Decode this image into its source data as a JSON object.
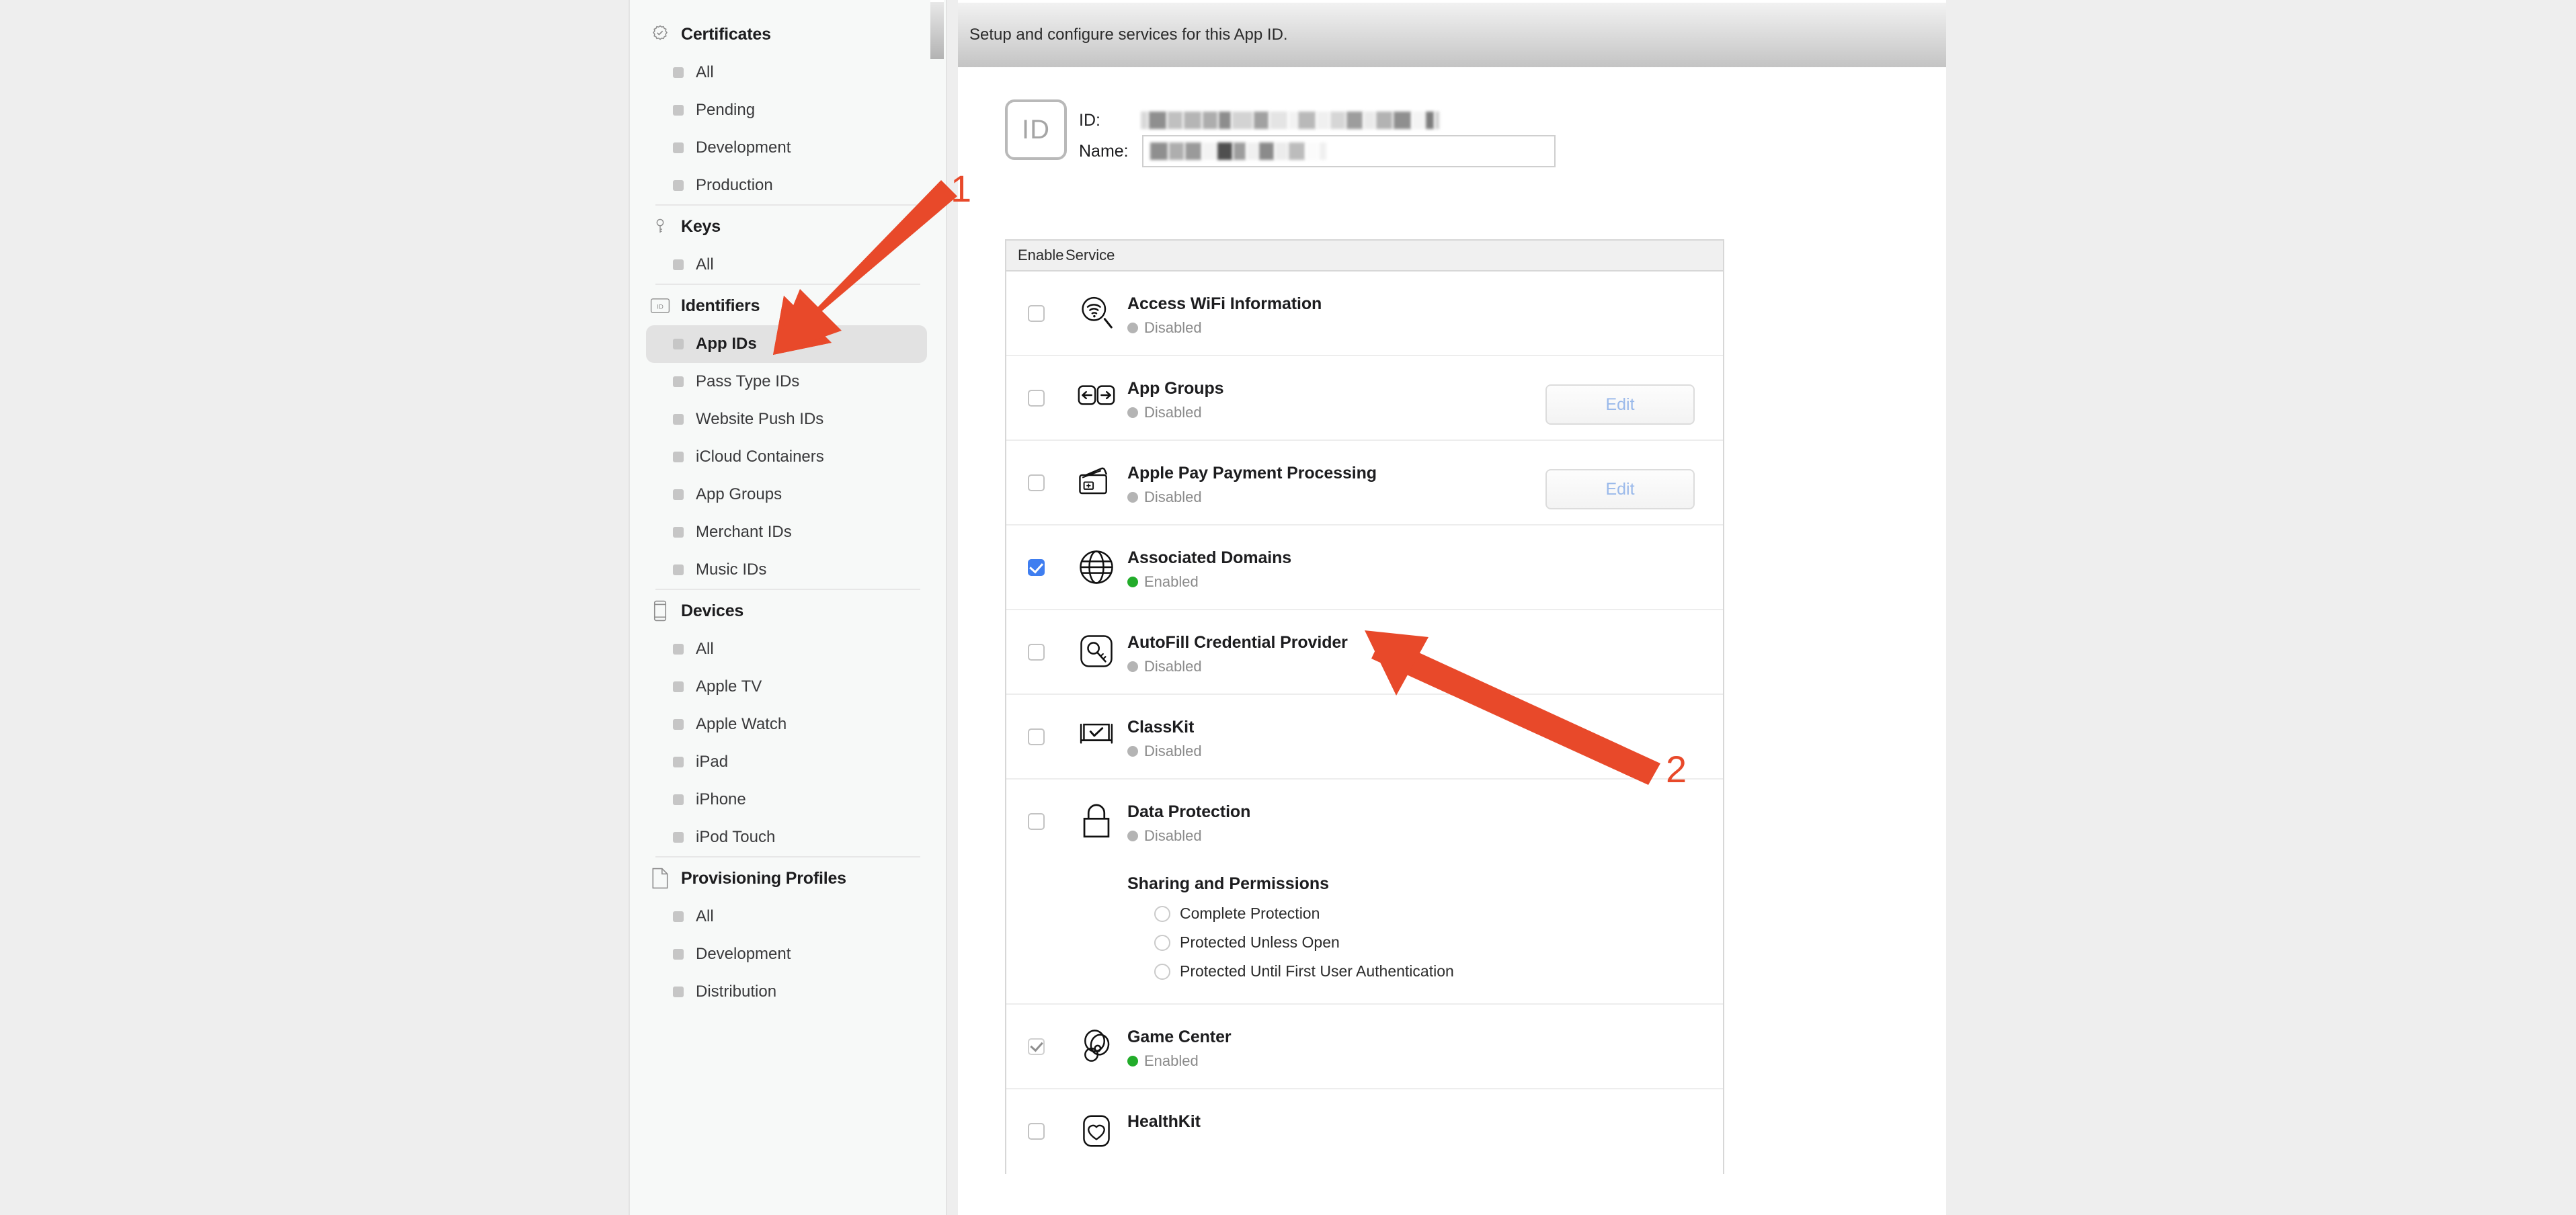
{
  "sidebar": {
    "groups": [
      {
        "label": "Certificates",
        "icon": "certificate-seal-icon",
        "items": [
          {
            "label": "All",
            "selected": false
          },
          {
            "label": "Pending",
            "selected": false
          },
          {
            "label": "Development",
            "selected": false
          },
          {
            "label": "Production",
            "selected": false
          }
        ]
      },
      {
        "label": "Keys",
        "icon": "key-icon",
        "items": [
          {
            "label": "All",
            "selected": false
          }
        ]
      },
      {
        "label": "Identifiers",
        "icon": "id-card-icon",
        "items": [
          {
            "label": "App IDs",
            "selected": true
          },
          {
            "label": "Pass Type IDs",
            "selected": false
          },
          {
            "label": "Website Push IDs",
            "selected": false
          },
          {
            "label": "iCloud Containers",
            "selected": false
          },
          {
            "label": "App Groups",
            "selected": false
          },
          {
            "label": "Merchant IDs",
            "selected": false
          },
          {
            "label": "Music IDs",
            "selected": false
          }
        ]
      },
      {
        "label": "Devices",
        "icon": "device-phone-icon",
        "items": [
          {
            "label": "All",
            "selected": false
          },
          {
            "label": "Apple TV",
            "selected": false
          },
          {
            "label": "Apple Watch",
            "selected": false
          },
          {
            "label": "iPad",
            "selected": false
          },
          {
            "label": "iPhone",
            "selected": false
          },
          {
            "label": "iPod Touch",
            "selected": false
          }
        ]
      },
      {
        "label": "Provisioning Profiles",
        "icon": "document-page-icon",
        "items": [
          {
            "label": "All",
            "selected": false
          },
          {
            "label": "Development",
            "selected": false
          },
          {
            "label": "Distribution",
            "selected": false
          }
        ]
      }
    ]
  },
  "main": {
    "header_text": "Setup and configure services for this App ID.",
    "id_badge_label": "ID",
    "id_label": "ID:",
    "name_label": "Name:",
    "id_value": "",
    "name_value": "",
    "table": {
      "columns": [
        "Enable",
        "Service"
      ],
      "rows": [
        {
          "name": "Access WiFi Information",
          "icon": "wifi-magnifier-icon",
          "status": "Disabled",
          "enabled": false,
          "checkbox": "unchecked",
          "action": null
        },
        {
          "name": "App Groups",
          "icon": "app-groups-arrows-icon",
          "status": "Disabled",
          "enabled": false,
          "checkbox": "unchecked",
          "action": "Edit"
        },
        {
          "name": "Apple Pay Payment Processing",
          "icon": "credit-cards-icon",
          "status": "Disabled",
          "enabled": false,
          "checkbox": "unchecked",
          "action": "Edit"
        },
        {
          "name": "Associated Domains",
          "icon": "globe-icon",
          "status": "Enabled",
          "enabled": true,
          "checkbox": "checked",
          "action": null
        },
        {
          "name": "AutoFill Credential Provider",
          "icon": "key-rounded-square-icon",
          "status": "Disabled",
          "enabled": false,
          "checkbox": "unchecked",
          "action": null
        },
        {
          "name": "ClassKit",
          "icon": "classkit-desk-check-icon",
          "status": "Disabled",
          "enabled": false,
          "checkbox": "unchecked",
          "action": null
        },
        {
          "name": "Data Protection",
          "icon": "padlock-icon",
          "status": "Disabled",
          "enabled": false,
          "checkbox": "unchecked",
          "action": null,
          "sub_block": {
            "title": "Sharing and Permissions",
            "options": [
              {
                "label": "Complete Protection",
                "selected": false
              },
              {
                "label": "Protected Unless Open",
                "selected": false
              },
              {
                "label": "Protected Until First User Authentication",
                "selected": false
              }
            ]
          }
        },
        {
          "name": "Game Center",
          "icon": "game-center-balloons-icon",
          "status": "Enabled",
          "enabled": true,
          "checkbox": "checked-disabled",
          "action": null
        },
        {
          "name": "HealthKit",
          "icon": "healthkit-heart-icon",
          "status": "",
          "enabled": false,
          "checkbox": "unchecked",
          "action": null
        }
      ]
    }
  },
  "annotations": [
    {
      "number": "1",
      "target": "sidebar-item-app-ids",
      "color": "#e8492a"
    },
    {
      "number": "2",
      "target": "service-associated-domains",
      "color": "#e8492a"
    }
  ],
  "colors": {
    "accent_orange": "#e8492a",
    "checkbox_blue": "#3f7ef0",
    "status_enabled_green": "#22ac2a",
    "status_disabled_gray": "#b4b4b4",
    "edit_link_blue": "#9ab9ea"
  }
}
